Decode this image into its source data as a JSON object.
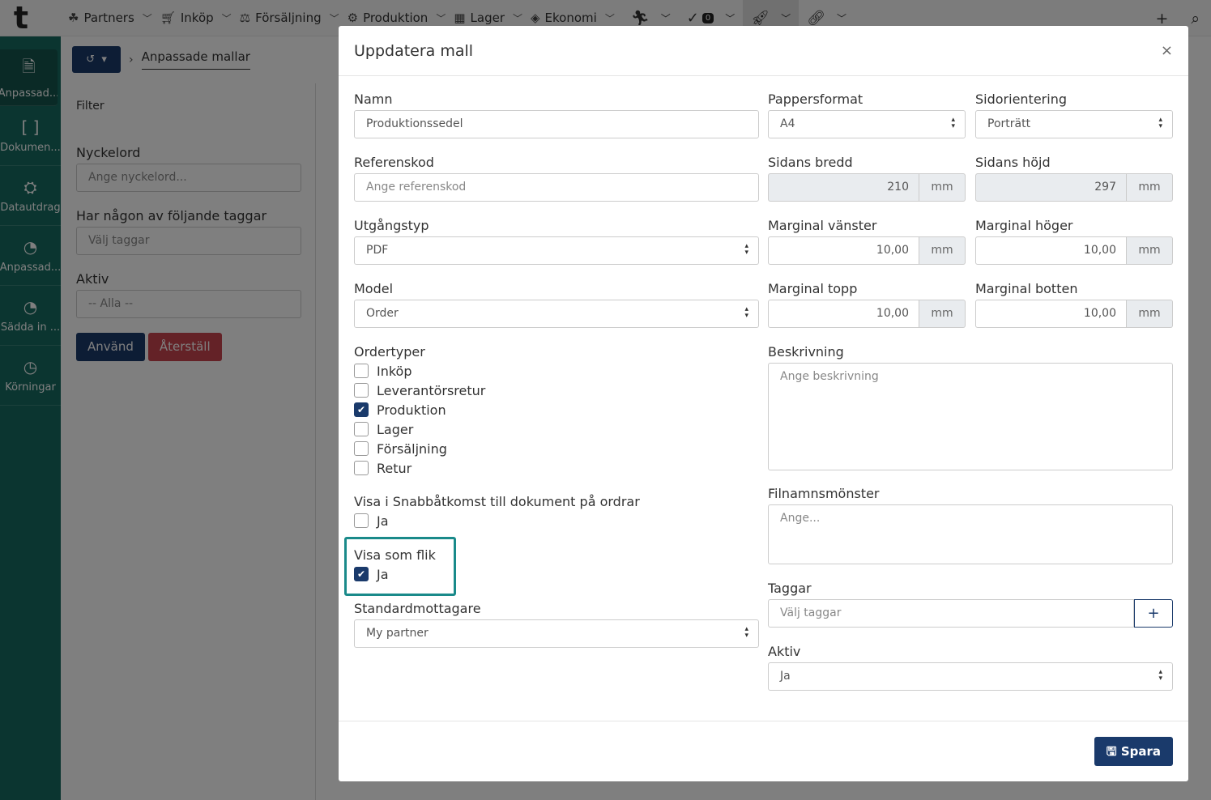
{
  "topnav": {
    "logo": "t",
    "items": [
      {
        "label": "Partners",
        "icon": "partners-icon"
      },
      {
        "label": "Inköp",
        "icon": "cart-icon"
      },
      {
        "label": "Försäljning",
        "icon": "sales-icon"
      },
      {
        "label": "Produktion",
        "icon": "production-icon"
      },
      {
        "label": "Lager",
        "icon": "warehouse-icon"
      },
      {
        "label": "Ekonomi",
        "icon": "money-icon"
      }
    ],
    "task_count": "0"
  },
  "sidebar": {
    "items": [
      {
        "label": "Anpassad...",
        "icon": "code-file-icon"
      },
      {
        "label": "Dokumen...",
        "icon": "brackets-icon"
      },
      {
        "label": "Datautdrag",
        "icon": "ufo-icon"
      },
      {
        "label": "Anpassad...",
        "icon": "gauge-icon"
      },
      {
        "label": "Sädda in ...",
        "icon": "gauge-icon"
      },
      {
        "label": "Körningar",
        "icon": "clock-icon"
      }
    ]
  },
  "breadcrumb": {
    "current": "Anpassade mallar"
  },
  "filter": {
    "title": "Filter",
    "keyword_label": "Nyckelord",
    "keyword_placeholder": "Ange nyckelord...",
    "tags_label": "Har någon av följande taggar",
    "tags_placeholder": "Välj taggar",
    "active_label": "Aktiv",
    "active_value": "-- Alla --",
    "apply": "Använd",
    "reset": "Återställ"
  },
  "modal": {
    "title": "Uppdatera mall",
    "close": "×",
    "name_label": "Namn",
    "name_value": "Produktionssedel",
    "ref_label": "Referenskod",
    "ref_placeholder": "Ange referenskod",
    "output_label": "Utgångstyp",
    "output_value": "PDF",
    "model_label": "Model",
    "model_value": "Order",
    "ordertypes_label": "Ordertyper",
    "ordertypes": [
      {
        "label": "Inköp",
        "checked": false
      },
      {
        "label": "Leverantörsretur",
        "checked": false
      },
      {
        "label": "Produktion",
        "checked": true
      },
      {
        "label": "Lager",
        "checked": false
      },
      {
        "label": "Försäljning",
        "checked": false
      },
      {
        "label": "Retur",
        "checked": false
      }
    ],
    "quick_access_label": "Visa i Snabbåtkomst till dokument på ordrar",
    "quick_access_option": "Ja",
    "show_tab_label": "Visa som flik",
    "show_tab_option": "Ja",
    "recipient_label": "Standardmottagare",
    "recipient_value": "My partner",
    "paper_label": "Pappersformat",
    "paper_value": "A4",
    "orientation_label": "Sidorientering",
    "orientation_value": "Porträtt",
    "width_label": "Sidans bredd",
    "width_value": "210",
    "height_label": "Sidans höjd",
    "height_value": "297",
    "unit": "mm",
    "ml_label": "Marginal vänster",
    "ml_value": "10,00",
    "mr_label": "Marginal höger",
    "mr_value": "10,00",
    "mt_label": "Marginal topp",
    "mt_value": "10,00",
    "mb_label": "Marginal botten",
    "mb_value": "10,00",
    "desc_label": "Beskrivning",
    "desc_placeholder": "Ange beskrivning",
    "filename_label": "Filnamnsmönster",
    "filename_placeholder": "Ange...",
    "tags_label": "Taggar",
    "tags_placeholder": "Välj taggar",
    "active_label": "Aktiv",
    "active_value": "Ja",
    "save": "Spara"
  },
  "colors": {
    "primary": "#1a3a6b",
    "sidebar": "#176a60",
    "danger": "#c9454f",
    "highlight": "#1a8a8a"
  }
}
